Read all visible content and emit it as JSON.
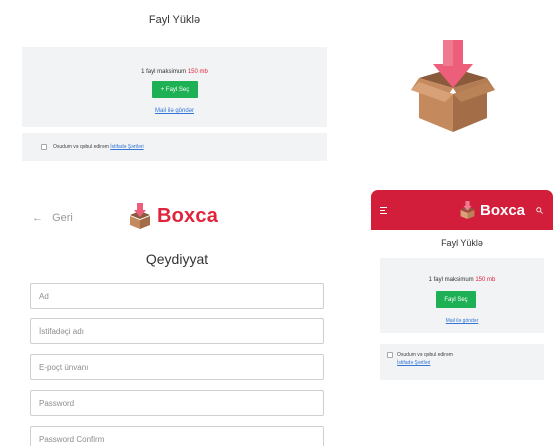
{
  "colors": {
    "brand_red": "#e0243b",
    "header_red": "#d21e3b",
    "green": "#1eb054",
    "link_blue": "#3576d6",
    "panel_gray": "#f2f3f5"
  },
  "desktop_upload": {
    "title": "Fayl Yüklə",
    "max_prefix": "1 fayl maksimum",
    "max_size": "150 mb",
    "button_label": "+ Fayl Seç",
    "mail_link": "Mail ilə göndər",
    "terms_prefix": "Oxudum və qəbul edirəm",
    "terms_link": "İstifadə Şərtləri"
  },
  "hero": {
    "icon": "box-download-icon"
  },
  "register": {
    "back_label": "Geri",
    "back_icon": "arrow-left-icon",
    "brand": "Boxca",
    "title": "Qeydiyyat",
    "fields": {
      "name": "Ad",
      "username": "İstifadəçi adı",
      "email": "E-poçt ünvanı",
      "password": "Password",
      "password_confirm": "Password Confirm"
    }
  },
  "mobile": {
    "brand": "Boxca",
    "menu_icon": "hamburger-icon",
    "search_icon": "search-icon",
    "title": "Fayl Yüklə",
    "max_prefix": "1 fayl maksimum",
    "max_size": "150 mb",
    "button_label": "Fayl Seç",
    "mail_link": "Mail ilə göndər",
    "terms_prefix": "Oxudum və qəbul edirəm",
    "terms_link": "İstifadə Şərtləri"
  }
}
